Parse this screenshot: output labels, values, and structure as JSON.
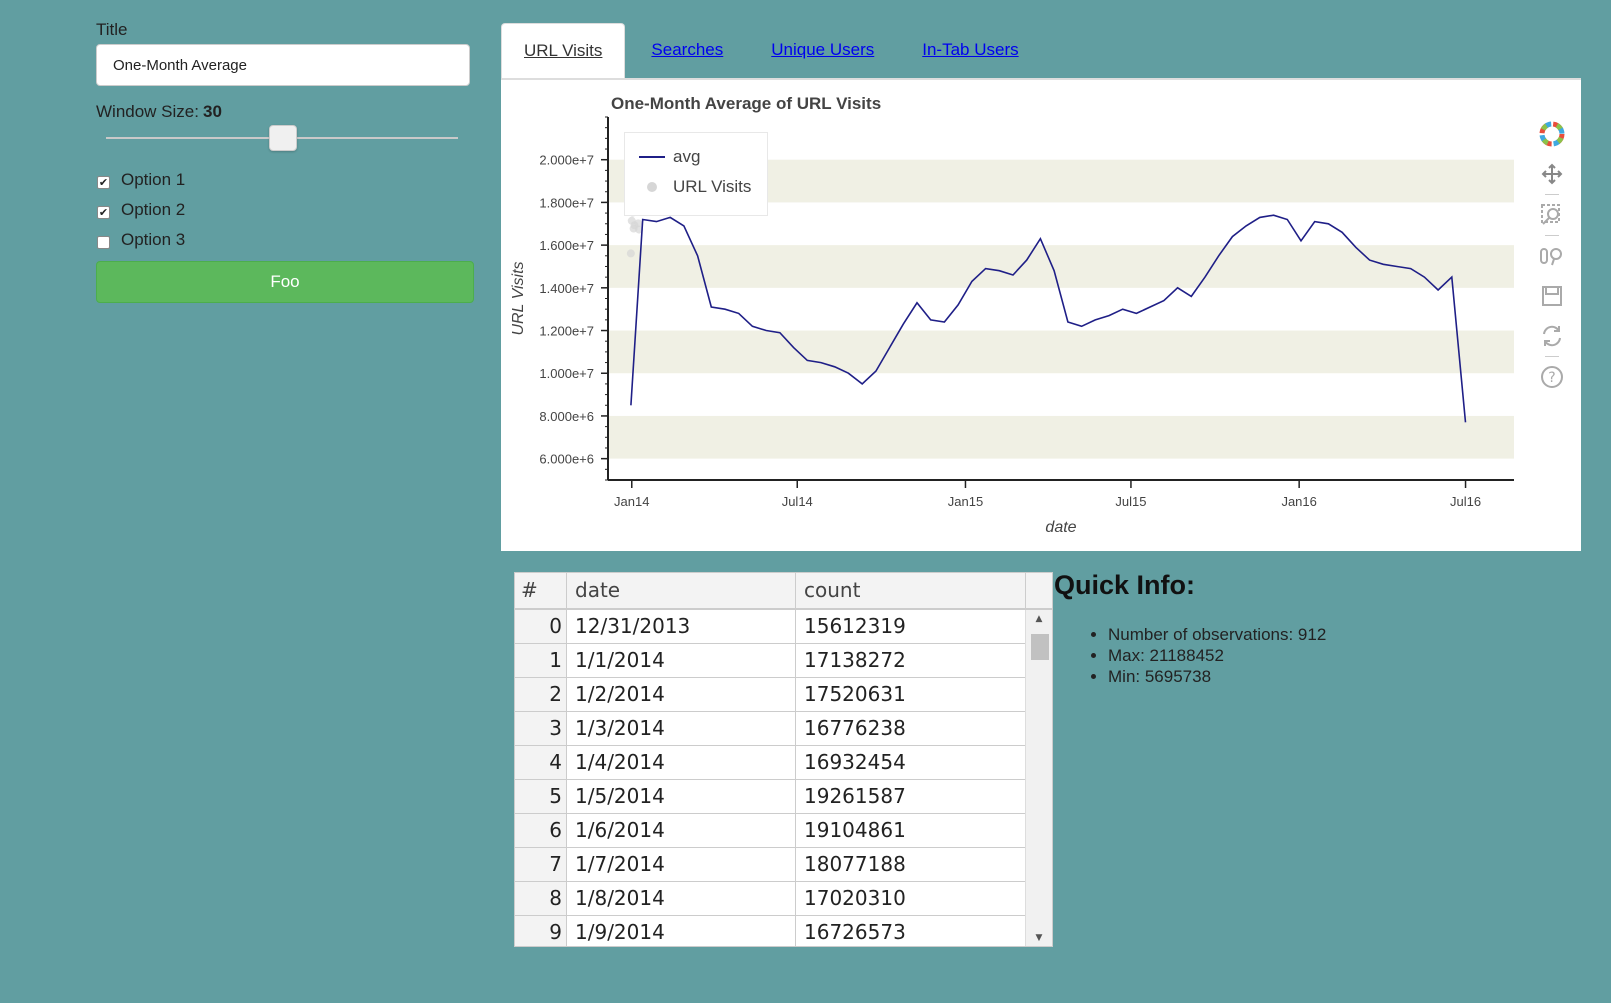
{
  "controls": {
    "title_label": "Title",
    "title_value": "One-Month Average",
    "window_label": "Window Size:",
    "window_value": "30",
    "slider": {
      "min": 1,
      "max": 100,
      "value": 30
    },
    "options": [
      {
        "label": "Option 1",
        "checked": true
      },
      {
        "label": "Option 2",
        "checked": true
      },
      {
        "label": "Option 3",
        "checked": false
      }
    ],
    "button_label": "Foo"
  },
  "tabs": [
    {
      "label": "URL Visits",
      "active": true
    },
    {
      "label": "Searches",
      "active": false
    },
    {
      "label": "Unique Users",
      "active": false
    },
    {
      "label": "In-Tab Users",
      "active": false
    }
  ],
  "toolbar": [
    "bokeh-logo-icon",
    "pan-icon",
    "box-zoom-icon",
    "wheel-zoom-icon",
    "save-icon",
    "reset-icon",
    "help-icon"
  ],
  "chart_data": {
    "type": "line",
    "title": "One-Month Average of URL Visits",
    "xlabel": "date",
    "ylabel": "URL Visits",
    "x_ticks": [
      "Jan14",
      "Jul14",
      "Jan15",
      "Jul15",
      "Jan16",
      "Jul16"
    ],
    "y_ticks": [
      "6.000e+6",
      "8.000e+6",
      "1.000e+7",
      "1.200e+7",
      "1.400e+7",
      "1.600e+7",
      "1.800e+7",
      "2.000e+7"
    ],
    "ylim": [
      5000000,
      22000000
    ],
    "xlim": [
      "2013-12-06",
      "2016-08-23"
    ],
    "legend": [
      "avg",
      "URL Visits"
    ],
    "legend_position": "top-left",
    "band_color": "#f0f0e4",
    "line_color": "#1f1f87",
    "series": [
      {
        "name": "avg",
        "kind": "line",
        "x": [
          "2013-12-31",
          "2014-01-13",
          "2014-01-28",
          "2014-02-12",
          "2014-02-27",
          "2014-03-14",
          "2014-03-29",
          "2014-04-13",
          "2014-04-28",
          "2014-05-13",
          "2014-05-28",
          "2014-06-12",
          "2014-06-27",
          "2014-07-12",
          "2014-07-27",
          "2014-08-11",
          "2014-08-26",
          "2014-09-10",
          "2014-09-25",
          "2014-10-10",
          "2014-10-25",
          "2014-11-09",
          "2014-11-24",
          "2014-12-09",
          "2014-12-24",
          "2015-01-08",
          "2015-01-23",
          "2015-02-07",
          "2015-02-22",
          "2015-03-09",
          "2015-03-24",
          "2015-04-08",
          "2015-04-23",
          "2015-05-08",
          "2015-05-23",
          "2015-06-07",
          "2015-06-22",
          "2015-07-07",
          "2015-07-22",
          "2015-08-06",
          "2015-08-21",
          "2015-09-05",
          "2015-09-20",
          "2015-10-05",
          "2015-10-20",
          "2015-11-04",
          "2015-11-19",
          "2015-12-04",
          "2015-12-19",
          "2016-01-03",
          "2016-01-18",
          "2016-02-02",
          "2016-02-17",
          "2016-03-03",
          "2016-03-18",
          "2016-04-02",
          "2016-04-17",
          "2016-05-02",
          "2016-05-17",
          "2016-06-01",
          "2016-06-16",
          "2016-07-01"
        ],
        "values": [
          8500000,
          17200000,
          17100000,
          17300000,
          16900000,
          15500000,
          13100000,
          13000000,
          12800000,
          12200000,
          12000000,
          11900000,
          11200000,
          10600000,
          10500000,
          10300000,
          10000000,
          9500000,
          10100000,
          11200000,
          12300000,
          13300000,
          12500000,
          12400000,
          13200000,
          14300000,
          14900000,
          14800000,
          14600000,
          15300000,
          16300000,
          14800000,
          12400000,
          12200000,
          12500000,
          12700000,
          13000000,
          12800000,
          13100000,
          13400000,
          14000000,
          13600000,
          14500000,
          15500000,
          16400000,
          16900000,
          17300000,
          17400000,
          17200000,
          16200000,
          17100000,
          17000000,
          16600000,
          15900000,
          15300000,
          15100000,
          15000000,
          14900000,
          14500000,
          13900000,
          14500000,
          7700000
        ]
      },
      {
        "name": "URL Visits",
        "kind": "scatter",
        "color": "#d6d6d6",
        "x": [
          "2013-12-31",
          "2014-01-01",
          "2014-01-02",
          "2014-01-03",
          "2014-01-04",
          "2014-01-05",
          "2014-01-06",
          "2014-01-07",
          "2014-01-08",
          "2014-01-09"
        ],
        "values": [
          15612319,
          17138272,
          17520631,
          16776238,
          16932454,
          19261587,
          19104861,
          18077188,
          17020310,
          16726573
        ]
      }
    ]
  },
  "table": {
    "headers": [
      "#",
      "date",
      "count"
    ],
    "rows": [
      [
        "0",
        "12/31/2013",
        "15612319"
      ],
      [
        "1",
        "1/1/2014",
        "17138272"
      ],
      [
        "2",
        "1/2/2014",
        "17520631"
      ],
      [
        "3",
        "1/3/2014",
        "16776238"
      ],
      [
        "4",
        "1/4/2014",
        "16932454"
      ],
      [
        "5",
        "1/5/2014",
        "19261587"
      ],
      [
        "6",
        "1/6/2014",
        "19104861"
      ],
      [
        "7",
        "1/7/2014",
        "18077188"
      ],
      [
        "8",
        "1/8/2014",
        "17020310"
      ],
      [
        "9",
        "1/9/2014",
        "16726573"
      ]
    ]
  },
  "quick_info": {
    "title": "Quick Info:",
    "items": [
      "Number of observations: 912",
      "Max: 21188452",
      "Min: 5695738"
    ]
  }
}
